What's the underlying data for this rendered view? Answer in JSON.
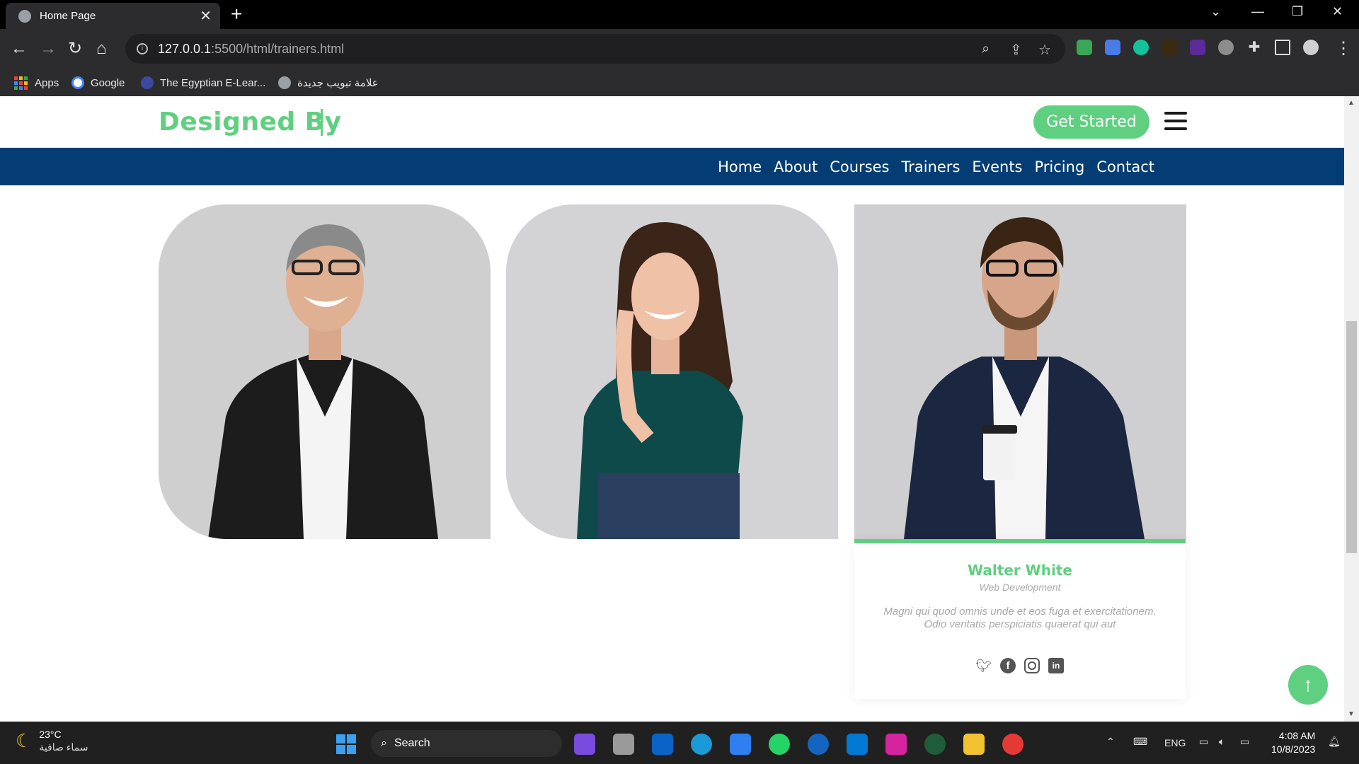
{
  "browser": {
    "tab_title": "Home Page",
    "new_tab_symbol": "+",
    "url_host": "127.0.0.1",
    "url_path": ":5500/html/trainers.html",
    "bookmarks": [
      {
        "label": "Apps"
      },
      {
        "label": "Google"
      },
      {
        "label": "The Egyptian E-Lear..."
      },
      {
        "label": "علامة تبويب جديدة"
      }
    ]
  },
  "header": {
    "logo": "Designed By",
    "cta": "Get Started"
  },
  "nav": {
    "items": [
      "Home",
      "About",
      "Courses",
      "Trainers",
      "Events",
      "Pricing",
      "Contact"
    ]
  },
  "trainer": {
    "name": "Walter White",
    "role": "Web Development",
    "description": "Magni qui quod omnis unde et eos fuga et exercitationem. Odio veritatis perspiciatis quaerat qui aut"
  },
  "taskbar": {
    "temperature": "23°C",
    "condition": "سماء صافية",
    "search_label": "Search",
    "language": "ENG",
    "time": "4:08 AM",
    "date": "10/8/2023"
  },
  "colors": {
    "accent": "#5fcf80",
    "nav": "#033d73"
  }
}
